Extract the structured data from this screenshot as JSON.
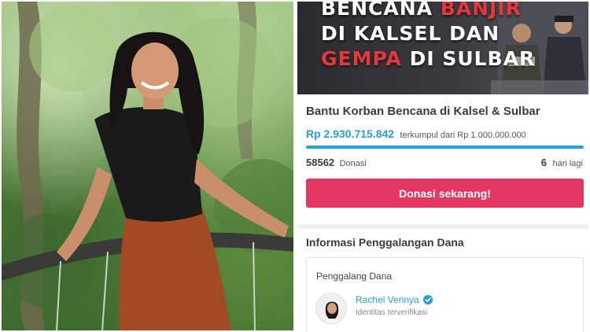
{
  "banner": {
    "line1_a": "BENCANA ",
    "line1_b": "BANJIR",
    "line2": "DI KALSEL DAN",
    "line3_a": "GEMPA",
    "line3_b": " DI SULBAR"
  },
  "campaign": {
    "title": "Bantu Korban Bencana di Kalsel & Sulbar",
    "amount": "Rp 2.930.715.842",
    "collected_text": "terkumpul dari Rp 1.000.000.000",
    "progress_fraction": 1.0,
    "donors_count": "58562",
    "donors_label": "Donasi",
    "days_count": "6",
    "days_label": "hari lagi",
    "donate_label": "Donasi sekarang!"
  },
  "info": {
    "title": "Informasi Penggalangan Dana",
    "fundraiser_label": "Penggalang Dana",
    "fundraiser_name": "Rachel Vennya",
    "verified_text": "Identitas terverifikasi"
  },
  "colors": {
    "accent_blue": "#2d9bd3",
    "donate_pink": "#e33862",
    "banner_red": "#e5373e"
  },
  "icons": {
    "verified": "verified-badge-icon"
  }
}
